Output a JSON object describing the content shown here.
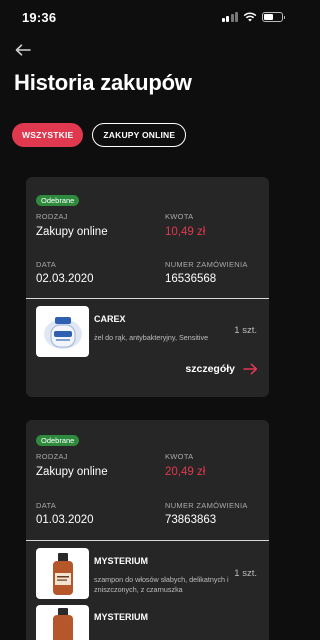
{
  "status_bar": {
    "time": "19:36"
  },
  "header": {
    "title": "Historia zakupów"
  },
  "filters": [
    {
      "label": "WSZYSTKIE",
      "active": true
    },
    {
      "label": "ZAKUPY ONLINE",
      "active": false
    }
  ],
  "orders": [
    {
      "status": "Odebrane",
      "type_label": "RODZAJ",
      "type_value": "Zakupy online",
      "amount_label": "KWOTA",
      "amount_value": "10,49 zł",
      "date_label": "DATA",
      "date_value": "02.03.2020",
      "order_no_label": "NUMER ZAMÓWIENIA",
      "order_no_value": "16536568",
      "product": {
        "name": "CAREX",
        "description": "żel do rąk, antybakteryjny, Sensitive",
        "quantity": "1 szt."
      },
      "details_label": "szczegóły"
    },
    {
      "status": "Odebrane",
      "type_label": "RODZAJ",
      "type_value": "Zakupy online",
      "amount_label": "KWOTA",
      "amount_value": "20,49 zł",
      "date_label": "DATA",
      "date_value": "01.03.2020",
      "order_no_label": "NUMER ZAMÓWIENIA",
      "order_no_value": "73863863",
      "product": {
        "name": "MYSTERIUM",
        "description": "szampon do włosów słabych, delikatnych i zniszczonych, z czarnuszka",
        "quantity": "1 szt."
      },
      "next_product_name": "MYSTERIUM"
    }
  ],
  "colors": {
    "accent": "#e0394f",
    "badge": "#2e8b3e",
    "card": "#262626",
    "background": "#0e0e0e"
  },
  "icons": [
    "back-arrow-icon",
    "arrow-right-icon",
    "signal-icon",
    "wifi-icon",
    "battery-icon"
  ]
}
